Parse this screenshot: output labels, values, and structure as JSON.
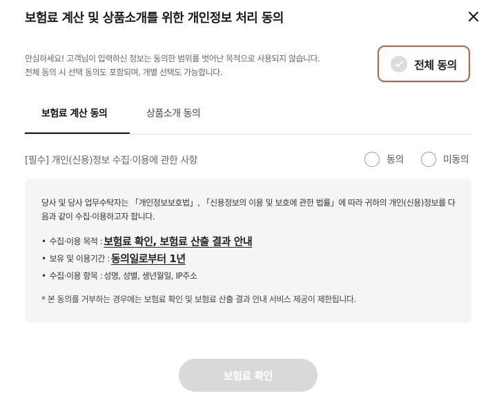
{
  "modal": {
    "title": "보험료 계산 및 상품소개를 위한 개인정보 처리 동의",
    "close_icon": "close-icon"
  },
  "intro": {
    "line1": "안심하세요! 고객님이 입력하신 정보는 동의한 범위를 벗어난 목적으로 사용되지 않습니다.",
    "line2": "전체 동의 시 선택 동의도 포함되며, 개별 선택도 가능합니다."
  },
  "agree_all": {
    "label": "전체 동의",
    "checked": false,
    "icon": "check-icon"
  },
  "tabs": [
    {
      "label": "보험료 계산 동의",
      "active": true
    },
    {
      "label": "상품소개 동의",
      "active": false
    }
  ],
  "consent": {
    "title": "[필수] 개인(신용)정보 수집·이용에 관한 사항",
    "agree_label": "동의",
    "disagree_label": "미동의",
    "selected": null
  },
  "details": {
    "description": "당사 및 당사 업무수탁자는 「개인정보보호법」, 「신용정보의 이용 및 보호에 관한 법률」에 따라 귀하의 개인(신용)정보를 다음과 같이 수집·이용하고자 합니다.",
    "items": [
      {
        "label": "수집·이용 목적 :",
        "value": "보험료 확인, 보험료 산출 결과 안내"
      },
      {
        "label": "보유 및 이용기간 :",
        "value": "동의일로부터 1년"
      },
      {
        "label": "수집·이용 항목 :",
        "value": "성명, 성별, 생년월일, IP주소"
      }
    ],
    "note": "* 본 동의를 거부하는 경우에는 보험료 확인 및 보험료 산출 결과 안내 서비스 제공이 제한됩니다."
  },
  "confirm_button": {
    "label": "보험료 확인",
    "enabled": false
  },
  "colors": {
    "agree_all_border": "#c65a40",
    "confirm_disabled_bg": "#d9d9d9",
    "info_box_bg": "#f5f5f5"
  }
}
